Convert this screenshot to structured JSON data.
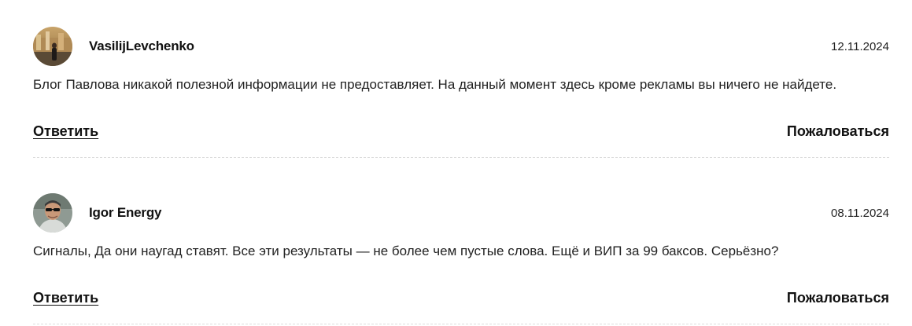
{
  "comments": [
    {
      "author": "VasilijLevchenko",
      "date": "12.11.2024",
      "text": "Блог Павлова никакой полезной информации не предоставляет. На данный момент здесь кроме рекламы вы ничего не найдете.",
      "reply_label": "Ответить",
      "report_label": "Пожаловаться"
    },
    {
      "author": "Igor Energy",
      "date": "08.11.2024",
      "text": "Сигналы, Да они наугад ставят. Все эти результаты — не более чем пустые слова. Ещё и ВИП за 99 баксов. Серьёзно?",
      "reply_label": "Ответить",
      "report_label": "Пожаловаться"
    }
  ]
}
